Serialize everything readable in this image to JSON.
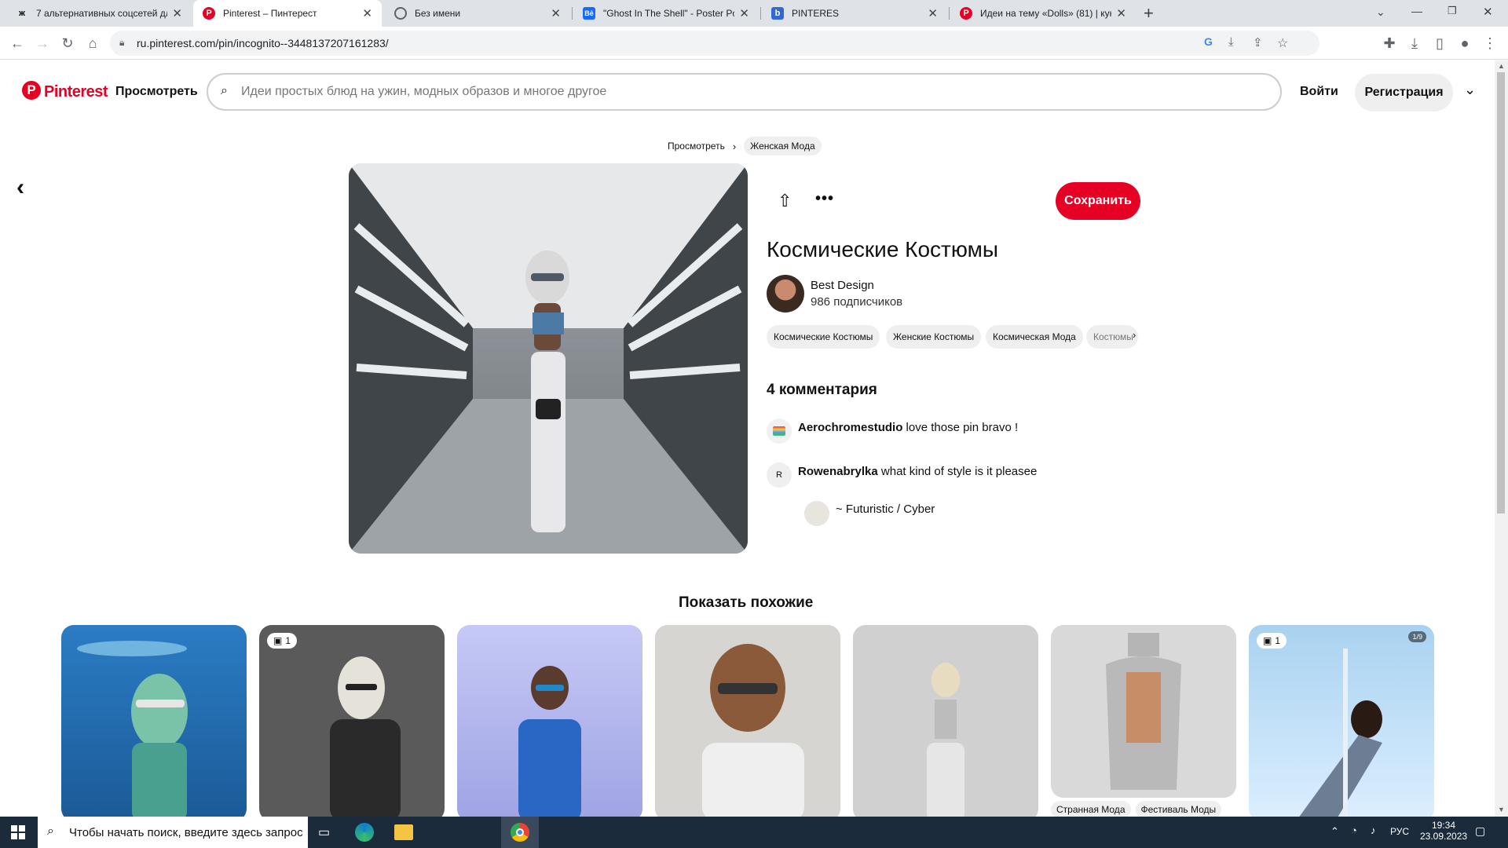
{
  "browser": {
    "tabs": [
      {
        "title": "7 альтернативных соцсетей для",
        "icon": "ж"
      },
      {
        "title": "Pinterest – Пинтерест",
        "icon": "P"
      },
      {
        "title": "Без имени",
        "icon": "g"
      },
      {
        "title": "\"Ghost In The Shell\" - Poster Pos",
        "icon": "Bē"
      },
      {
        "title": "PINTERES",
        "icon": "b"
      },
      {
        "title": "Идеи на тему «Dolls» (81) | кукл",
        "icon": "P"
      }
    ],
    "url": "ru.pinterest.com/pin/incognito--3448137207161283/"
  },
  "header": {
    "logo": "Pinterest",
    "browse": "Просмотреть",
    "search_placeholder": "Идеи простых блюд на ужин, модных образов и многое другое",
    "login": "Войти",
    "signup": "Регистрация"
  },
  "breadcrumb": {
    "root": "Просмотреть",
    "current": "Женская Мода"
  },
  "pin": {
    "save": "Сохранить",
    "title": "Космические Костюмы",
    "author": "Best Design",
    "followers": "986 подписчиков",
    "tags": [
      "Космические Костюмы",
      "Женские Костюмы",
      "Космическая Мода",
      "Костюмы"
    ],
    "comments_title": "4 комментария",
    "comments": [
      {
        "user": "Aerochromestudio",
        "text": "love those pin bravo !",
        "avatar": ""
      },
      {
        "user": "Rowenabrylka",
        "text": "what kind of style is it pleasee",
        "avatar": "R"
      }
    ],
    "reply": "~ Futuristic / Cyber"
  },
  "similar": {
    "title": "Показать похожие",
    "cards": [
      {
        "badge": ""
      },
      {
        "badge": "1"
      },
      {
        "badge": ""
      },
      {
        "badge": ""
      },
      {
        "badge": ""
      },
      {
        "badge": "",
        "tags": [
          "Странная Мода",
          "Фестиваль Моды"
        ]
      },
      {
        "badge": "1",
        "corner": "1/9"
      }
    ]
  },
  "taskbar": {
    "search": "Чтобы начать поиск, введите здесь запрос",
    "lang": "РУС",
    "time": "19:34",
    "date": "23.09.2023"
  },
  "colors": {
    "brand": "#e60023",
    "chip": "#efefef",
    "taskbar": "#1c2b3b"
  }
}
